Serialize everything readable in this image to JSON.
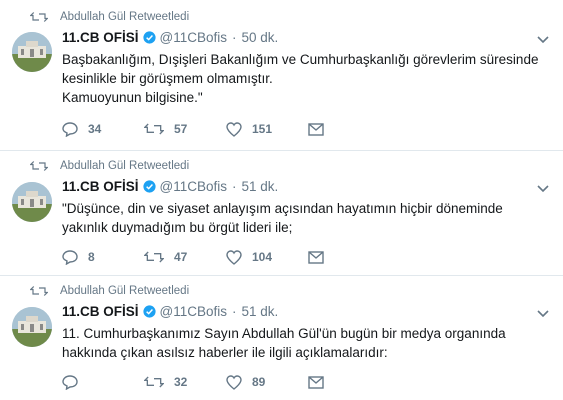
{
  "account": {
    "name": "11.CB OFİSİ",
    "handle": "@11CBofis"
  },
  "tweets": [
    {
      "retweeted_by": "Abdullah Gül Retweetledi",
      "time": "50 dk.",
      "lines": [
        "Başbakanlığım, Dışişleri Bakanlığım ve Cumhurbaşkanlığı görevlerim süresinde",
        "kesinlikle bir görüşmem olmamıştır.",
        "Kamuoyunun bilgisine.\""
      ],
      "replies": "34",
      "retweets": "57",
      "likes": "151"
    },
    {
      "retweeted_by": "Abdullah Gül Retweetledi",
      "time": "51 dk.",
      "lines": [
        "\"Düşünce, din ve siyaset anlayışım açısından hayatımın hiçbir döneminde",
        "yakınlık duymadığım bu örgüt lideri ile;"
      ],
      "replies": "8",
      "retweets": "47",
      "likes": "104"
    },
    {
      "retweeted_by": "Abdullah Gül Retweetledi",
      "time": "51 dk.",
      "lines": [
        "11. Cumhurbaşkanımız Sayın Abdullah Gül'ün bugün bir medya organında",
        "hakkında çıkan asılsız haberler ile ilgili açıklamalarıdır:"
      ],
      "replies": "",
      "retweets": "32",
      "likes": "89"
    }
  ],
  "icons": {
    "retweet": "retweet-icon",
    "reply": "reply-icon",
    "like": "heart-icon",
    "dm": "envelope-icon",
    "verified": "verified-badge-icon",
    "caret": "chevron-down-icon"
  },
  "colors": {
    "gray": "#657786",
    "verified": "#1da1f2",
    "text": "#14171a",
    "divider": "#e1e8ed"
  }
}
